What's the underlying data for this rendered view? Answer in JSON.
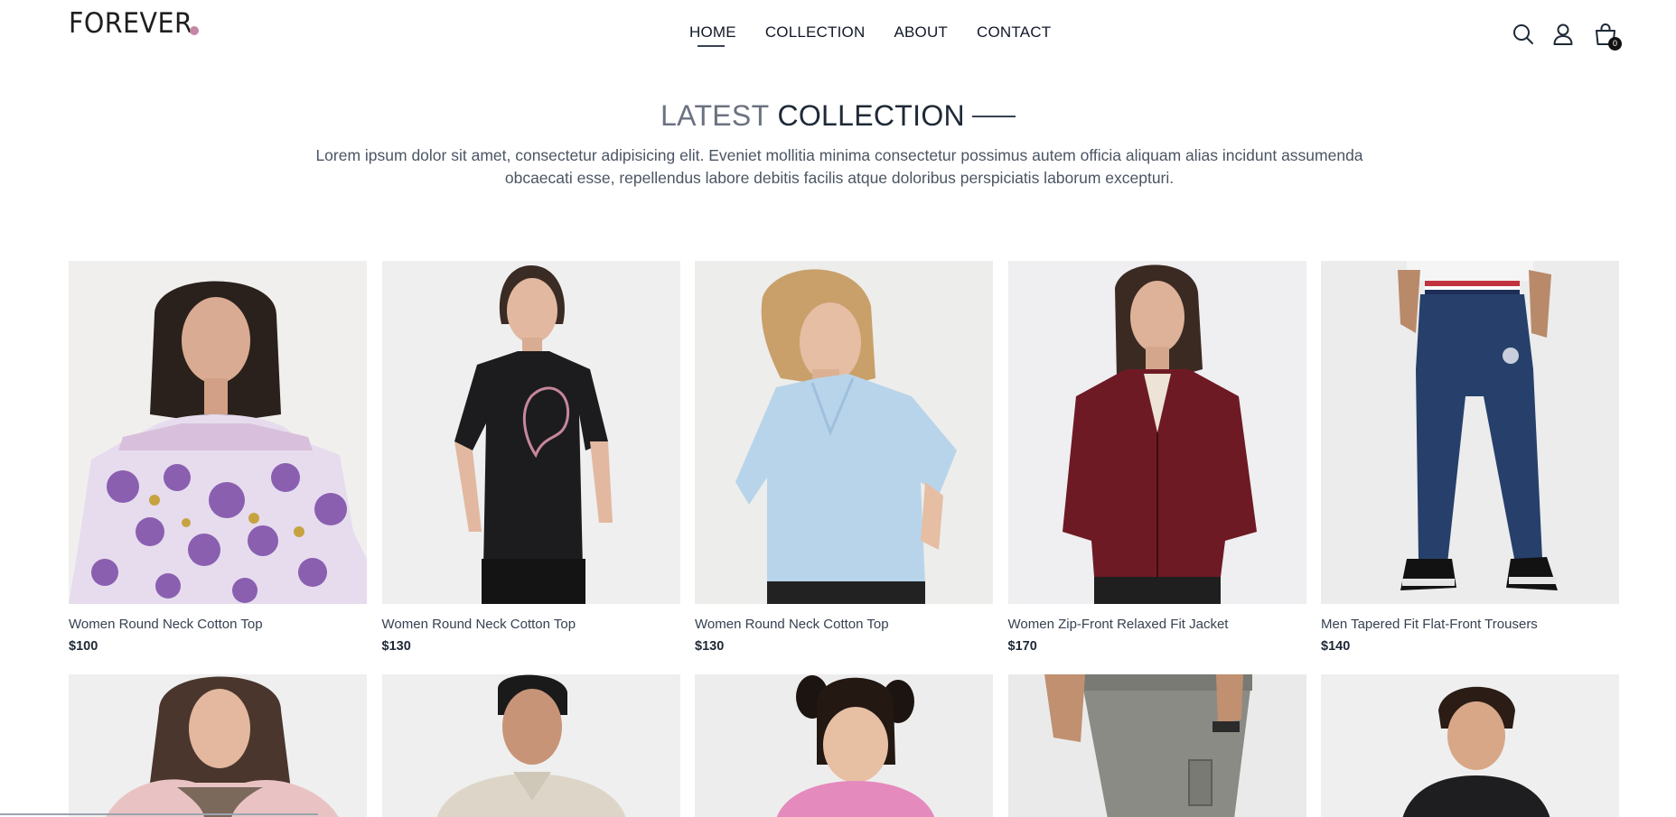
{
  "header": {
    "logo_text": "FOREVER",
    "nav": [
      {
        "label": "HOME"
      },
      {
        "label": "COLLECTION"
      },
      {
        "label": "ABOUT"
      },
      {
        "label": "CONTACT"
      }
    ],
    "icons": [
      "search-icon",
      "user-icon",
      "cart-icon"
    ],
    "cart_count": "0",
    "logo_dot_color": "#c586a5"
  },
  "section": {
    "title_light": "LATEST",
    "title_dark": "COLLECTION",
    "description": "Lorem ipsum dolor sit amet, consectetur adipisicing elit. Eveniet mollitia minima consectetur possimus autem officia aliquam alias incidunt assumenda obcaecati esse, repellendus labore debitis facilis atque doloribus perspiciatis laborum excepturi."
  },
  "products": [
    {
      "name": "Women Round Neck Cotton Top",
      "price": "$100"
    },
    {
      "name": "Women Round Neck Cotton Top",
      "price": "$130"
    },
    {
      "name": "Women Round Neck Cotton Top",
      "price": "$130"
    },
    {
      "name": "Women Zip-Front Relaxed Fit Jacket",
      "price": "$170"
    },
    {
      "name": "Men Tapered Fit Flat-Front Trousers",
      "price": "$140"
    }
  ]
}
